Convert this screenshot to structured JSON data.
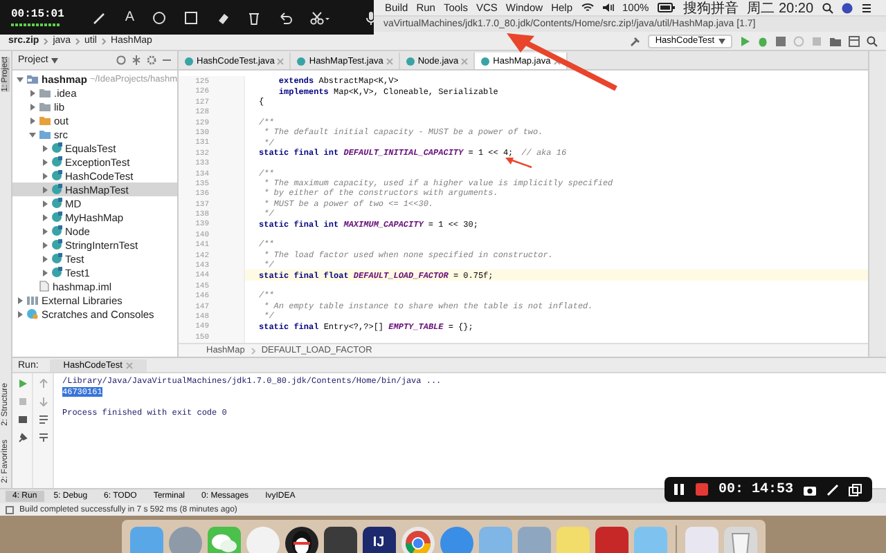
{
  "recorder_top": {
    "timer": "00:15:01",
    "text_tool": "A"
  },
  "menu_bar": {
    "items": [
      "Build",
      "Run",
      "Tools",
      "VCS",
      "Window",
      "Help"
    ],
    "battery": "100%",
    "input_method": "搜狗拼音",
    "clock": "周二 20:20"
  },
  "window": {
    "title": "vaVirtualMachines/jdk1.7.0_80.jdk/Contents/Home/src.zip!/java/util/HashMap.java [1.7]"
  },
  "breadcrumb": [
    "src.zip",
    "java",
    "util",
    "HashMap"
  ],
  "toolbar": {
    "run_config": "HashCodeTest"
  },
  "side_strip": {
    "top": "1: Project",
    "bottom": [
      "2: Structure",
      "2: Favorites"
    ]
  },
  "project": {
    "header": "Project",
    "tree": [
      {
        "label": "hashmap",
        "hint": "~/IdeaProjects/hashm",
        "kind": "module",
        "expanded": true,
        "selected": false,
        "children": [
          {
            "label": ".idea",
            "kind": "folder",
            "expanded": false,
            "selected": false
          },
          {
            "label": "lib",
            "kind": "folder",
            "expanded": false,
            "selected": false
          },
          {
            "label": "out",
            "kind": "excluded-folder",
            "expanded": false,
            "selected": false
          },
          {
            "label": "src",
            "kind": "source-folder",
            "expanded": true,
            "selected": false,
            "children": [
              {
                "label": "EqualsTest",
                "kind": "class",
                "expanded": false,
                "selected": false
              },
              {
                "label": "ExceptionTest",
                "kind": "class",
                "expanded": false,
                "selected": false
              },
              {
                "label": "HashCodeTest",
                "kind": "class",
                "expanded": false,
                "selected": false
              },
              {
                "label": "HashMapTest",
                "kind": "class",
                "expanded": false,
                "selected": true
              },
              {
                "label": "MD",
                "kind": "class",
                "expanded": false,
                "selected": false
              },
              {
                "label": "MyHashMap",
                "kind": "class",
                "expanded": false,
                "selected": false
              },
              {
                "label": "Node",
                "kind": "class",
                "expanded": false,
                "selected": false
              },
              {
                "label": "StringInternTest",
                "kind": "class",
                "expanded": false,
                "selected": false
              },
              {
                "label": "Test",
                "kind": "class",
                "expanded": false,
                "selected": false
              },
              {
                "label": "Test1",
                "kind": "class",
                "expanded": false,
                "selected": false
              }
            ]
          },
          {
            "label": "hashmap.iml",
            "kind": "file",
            "selected": false
          }
        ]
      },
      {
        "label": "External Libraries",
        "kind": "library",
        "expanded": false,
        "selected": false
      },
      {
        "label": "Scratches and Consoles",
        "kind": "scratches",
        "expanded": false,
        "selected": false
      }
    ]
  },
  "tabs": [
    {
      "label": "HashCodeTest.java",
      "selected": false
    },
    {
      "label": "HashMapTest.java",
      "selected": false
    },
    {
      "label": "Node.java",
      "selected": false
    },
    {
      "label": "HashMap.java",
      "selected": true
    }
  ],
  "editor": {
    "lines": [
      {
        "number": "125",
        "kind": "code",
        "text": "    **extends** AbstractMap<K,V>",
        "current": false
      },
      {
        "number": "126",
        "kind": "code",
        "text": "    **implements** Map<K,V>, Cloneable, Serializable",
        "current": false
      },
      {
        "number": "127",
        "kind": "code",
        "text": "{",
        "current": false
      },
      {
        "number": "128",
        "kind": "blank",
        "current": false
      },
      {
        "number": "129",
        "kind": "comment",
        "text": "/**",
        "current": false
      },
      {
        "number": "130",
        "kind": "comment",
        "text": " * The default initial capacity - MUST be a power of two.",
        "current": false
      },
      {
        "number": "131",
        "kind": "comment",
        "text": " */",
        "current": false
      },
      {
        "number": "132",
        "kind": "code",
        "text": "**static final int** *DEFAULT_INITIAL_CAPACITY* = 1 << 4;",
        "trailing_comment": "// aka 16",
        "current": false
      },
      {
        "number": "133",
        "kind": "blank",
        "current": false
      },
      {
        "number": "134",
        "kind": "comment",
        "text": "/**",
        "current": false
      },
      {
        "number": "135",
        "kind": "comment",
        "text": " * The maximum capacity, used if a higher value is implicitly specified",
        "current": false
      },
      {
        "number": "136",
        "kind": "comment",
        "text": " * by either of the constructors with arguments.",
        "current": false
      },
      {
        "number": "137",
        "kind": "comment",
        "text": " * MUST be a power of two <= 1<<30.",
        "current": false
      },
      {
        "number": "138",
        "kind": "comment",
        "text": " */",
        "current": false
      },
      {
        "number": "139",
        "kind": "code",
        "text": "**static final int** *MAXIMUM_CAPACITY* = 1 << 30;",
        "current": false
      },
      {
        "number": "140",
        "kind": "blank",
        "current": false
      },
      {
        "number": "141",
        "kind": "comment",
        "text": "/**",
        "current": false
      },
      {
        "number": "142",
        "kind": "comment",
        "text": " * The load factor used when none specified in constructor.",
        "current": false
      },
      {
        "number": "143",
        "kind": "comment",
        "text": " */",
        "current": false
      },
      {
        "number": "144",
        "kind": "code",
        "text": "**static final float** *DEFAULT_LOAD_FACTOR* = 0.75f;",
        "current": true
      },
      {
        "number": "145",
        "kind": "blank",
        "current": false
      },
      {
        "number": "146",
        "kind": "comment",
        "text": "/**",
        "current": false
      },
      {
        "number": "147",
        "kind": "comment",
        "text": " * An empty table instance to share when the table is not inflated.",
        "current": false
      },
      {
        "number": "148",
        "kind": "comment",
        "text": " */",
        "current": false
      },
      {
        "number": "149",
        "kind": "code",
        "text": "**static final** Entry<?,?>[] *EMPTY_TABLE* = {};",
        "current": false
      },
      {
        "number": "150",
        "kind": "blank",
        "current": false
      }
    ],
    "breadcrumb": [
      "HashMap",
      "DEFAULT_LOAD_FACTOR"
    ]
  },
  "run_panel": {
    "label": "Run:",
    "tab": "HashCodeTest",
    "output": [
      {
        "text": "/Library/Java/JavaVirtualMachines/jdk1.7.0_80.jdk/Contents/Home/bin/java ...",
        "selected": false
      },
      {
        "text": "46730161",
        "selected": true
      },
      {
        "text": "Process finished with exit code 0",
        "selected": false
      }
    ]
  },
  "tool_tabs": [
    {
      "label": "4: Run",
      "selected": true
    },
    {
      "label": "5: Debug",
      "selected": false
    },
    {
      "label": "6: TODO",
      "selected": false
    },
    {
      "label": "Terminal",
      "selected": false
    },
    {
      "label": "0: Messages",
      "selected": false
    },
    {
      "label": "IvyIDEA",
      "selected": false
    }
  ],
  "status_bar": {
    "text": "Build completed successfully in 7 s 592 ms (8 minutes ago)"
  },
  "recorder_bottom": {
    "timer": "00: 14:53"
  },
  "dock": [
    {
      "kind": "finder"
    },
    {
      "kind": "rocket"
    },
    {
      "kind": "chat"
    },
    {
      "kind": "circle"
    },
    {
      "kind": "penguin"
    },
    {
      "kind": "editor"
    },
    {
      "kind": "ide",
      "label": "IJ"
    },
    {
      "kind": "browser"
    },
    {
      "kind": "compass"
    },
    {
      "kind": "preview"
    },
    {
      "kind": "photos"
    },
    {
      "kind": "notes"
    },
    {
      "kind": "recorder"
    },
    {
      "kind": "player"
    },
    {
      "kind": "document"
    },
    {
      "kind": "trash"
    }
  ]
}
